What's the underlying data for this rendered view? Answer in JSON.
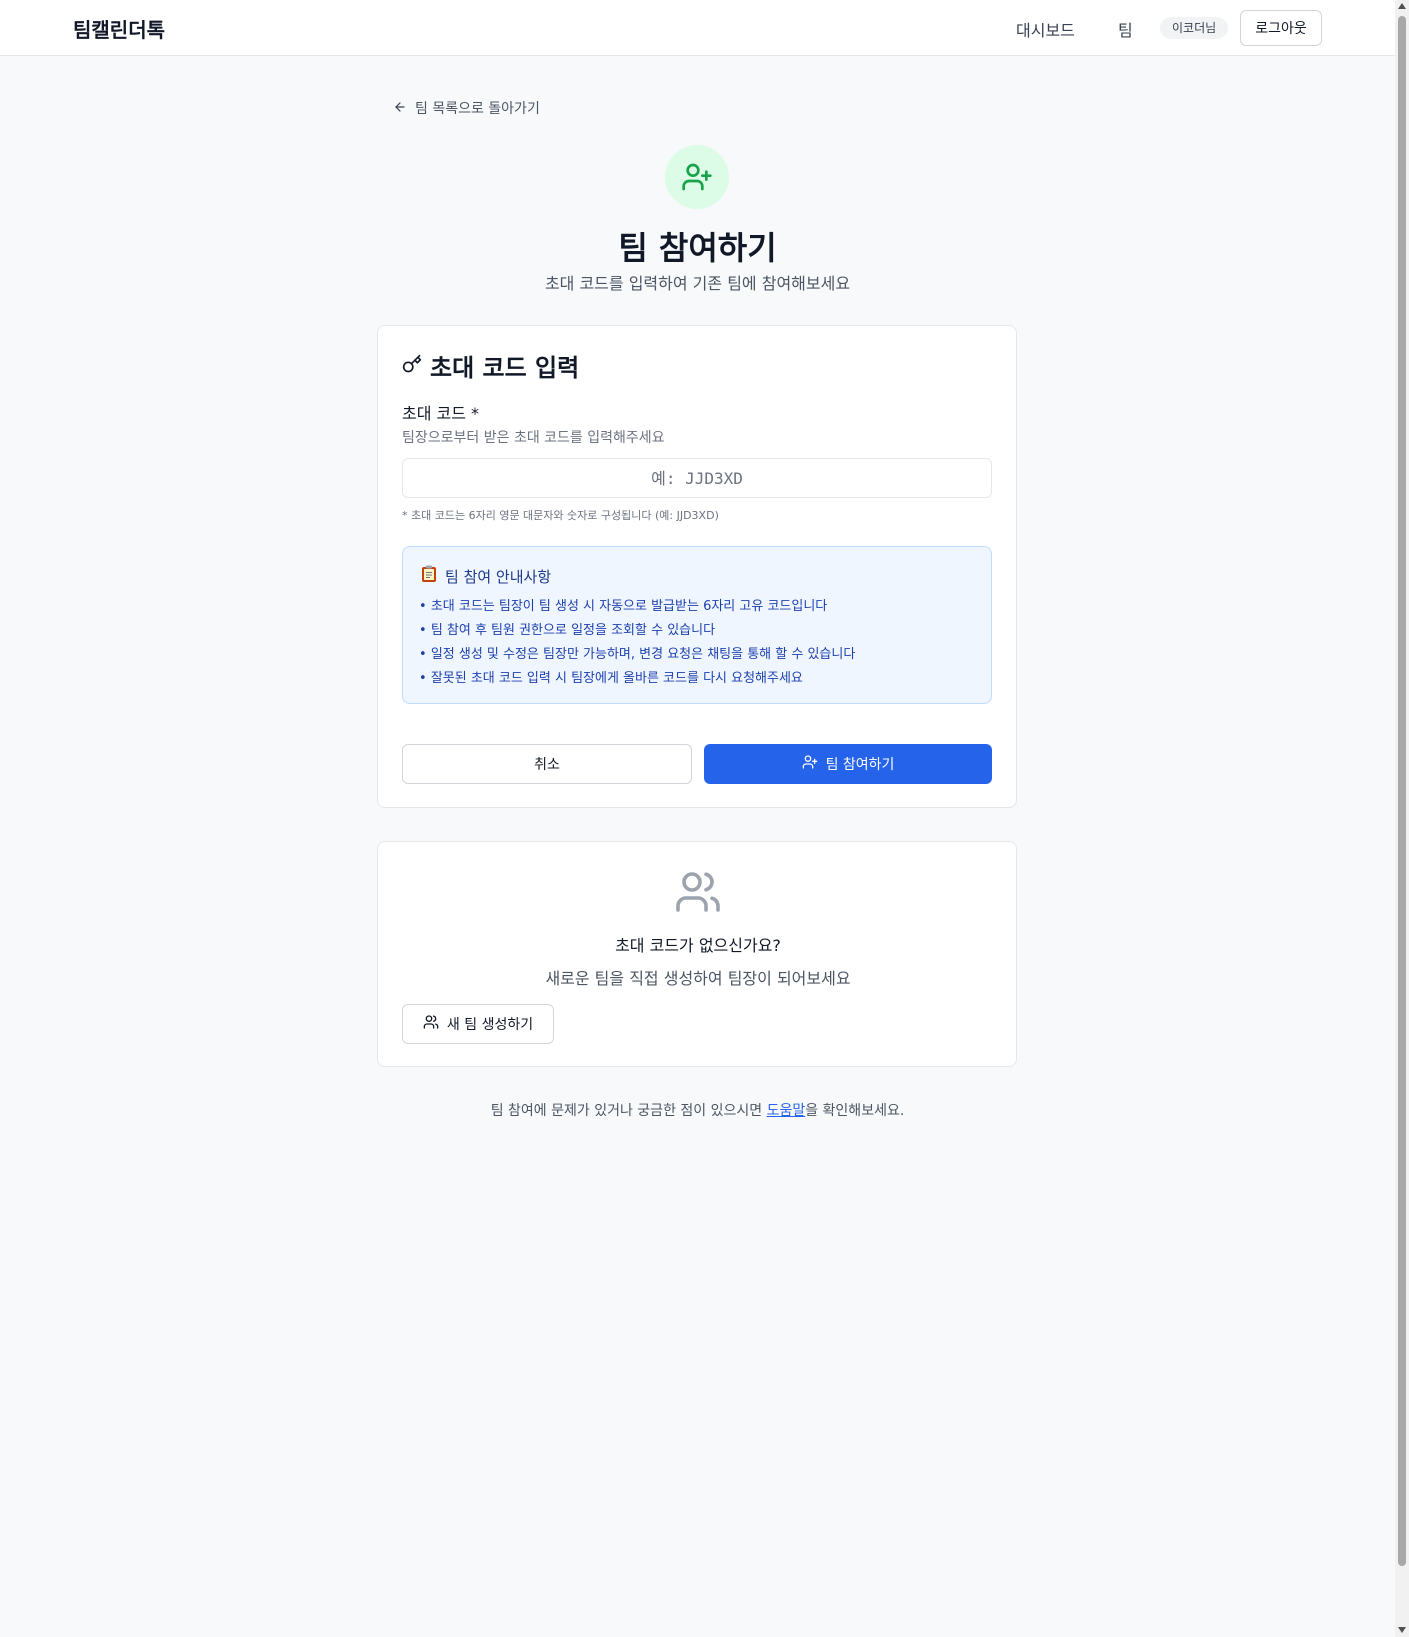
{
  "header": {
    "brand": "팀캘린더톡",
    "nav": {
      "dashboard": "대시보드",
      "team": "팀"
    },
    "user_badge": "이코더님",
    "logout_label": "로그아웃"
  },
  "back_link": {
    "label": "팀 목록으로 돌아가기"
  },
  "hero": {
    "title": "팀 참여하기",
    "subtitle": "초대 코드를 입력하여 기존 팀에 참여해보세요"
  },
  "invite_card": {
    "title": "초대 코드 입력",
    "field_label": "초대 코드 *",
    "field_help": "팀장으로부터 받은 초대 코드를 입력해주세요",
    "input_value": "",
    "input_placeholder": "예: JJD3XD",
    "field_note": "* 초대 코드는 6자리 영문 대문자와 숫자로 구성됩니다 (예: JJD3XD)",
    "info": {
      "title": "팀 참여 안내사항",
      "items": [
        "초대 코드는 팀장이 팀 생성 시 자동으로 발급받는 6자리 고유 코드입니다",
        "팀 참여 후 팀원 권한으로 일정을 조회할 수 있습니다",
        "일정 생성 및 수정은 팀장만 가능하며, 변경 요청은 채팅을 통해 할 수 있습니다",
        "잘못된 초대 코드 입력 시 팀장에게 올바른 코드를 다시 요청해주세요"
      ]
    },
    "cancel_label": "취소",
    "join_label": "팀 참여하기"
  },
  "no_code_card": {
    "title": "초대 코드가 없으신가요?",
    "subtitle": "새로운 팀을 직접 생성하여 팀장이 되어보세요",
    "button_label": "새 팀 생성하기"
  },
  "footer": {
    "before": "팀 참여에 문제가 있거나 궁금한 점이 있으시면 ",
    "link": "도움말",
    "after": "을 확인해보세요."
  },
  "colors": {
    "primary": "#2563eb",
    "hero_icon_bg": "#dcfce7",
    "hero_icon": "#16a34a",
    "info_bg": "#eff6ff",
    "info_text": "#1e40af"
  },
  "icons": {
    "back": "arrow-left-icon",
    "hero": "user-plus-icon",
    "card_title": "key-icon",
    "info": "clipboard-icon",
    "join": "user-plus-icon",
    "no_code": "users-icon",
    "new_team": "users-icon"
  }
}
